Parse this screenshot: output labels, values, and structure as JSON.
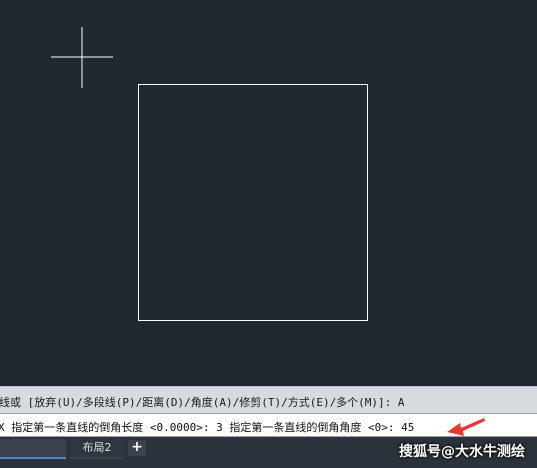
{
  "command_line": {
    "history_text": "线或 [放弃(U)/多段线(P)/距离(D)/角度(A)/修剪(T)/方式(E)/多个(M)]:  A",
    "input_text": "X 指定第一条直线的倒角长度 <0.0000>: 3 指定第一条直线的倒角角度 <0>: 45"
  },
  "layout_tabs": {
    "tabs": [
      {
        "label": ""
      },
      {
        "label": "布局2"
      }
    ],
    "add_label": "+"
  },
  "watermark": "搜狐号@大水牛测绘",
  "colors": {
    "canvas_background": "#212830",
    "drawing_lines": "#ffffff",
    "crosshair": "#ffffff",
    "annotation_arrow": "#e53935",
    "command_history_bg": "#d7dadf",
    "command_input_bg": "#ffffff",
    "tab_bar_bg": "#2b323b"
  },
  "icons": {
    "crosshair": "crosshair-cursor",
    "arrow": "red-annotation-arrow"
  }
}
